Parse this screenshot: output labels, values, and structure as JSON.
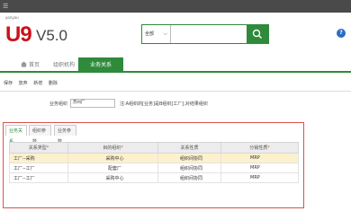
{
  "brand": {
    "small": "yonyou",
    "product": "U9",
    "version": "V5.0"
  },
  "search": {
    "scope": "全部",
    "placeholder": ""
  },
  "nav": {
    "home": "首页",
    "org": "组织机构",
    "business": "业务关系"
  },
  "toolbar": {
    "items": [
      "保存",
      "放弃",
      "新增",
      "删除"
    ]
  },
  "form": {
    "label": "业务组织",
    "value": "苏州厂",
    "hint": "注:A组织的[业务]是B组织[工厂],对结果组织"
  },
  "tabs": [
    "业务关系",
    "组织参数",
    "业务参数"
  ],
  "table": {
    "headers": [
      "关系类型",
      "目的组织",
      "关系性质",
      "分销性质"
    ],
    "rows": [
      [
        "工厂--采购",
        "采购中心",
        "组织间协同",
        "MRP"
      ],
      [
        "工厂--工厂",
        "配套厂",
        "组织间协同",
        "MRP"
      ],
      [
        "工厂--工厂",
        "采购中心",
        "组织间协同",
        "MRP"
      ]
    ],
    "selected_row": 0
  },
  "colors": {
    "accent": "#2f8a3c",
    "brand_red": "#c8131a",
    "panel_border": "#d9534f",
    "selected_row": "#fdf1cd"
  }
}
